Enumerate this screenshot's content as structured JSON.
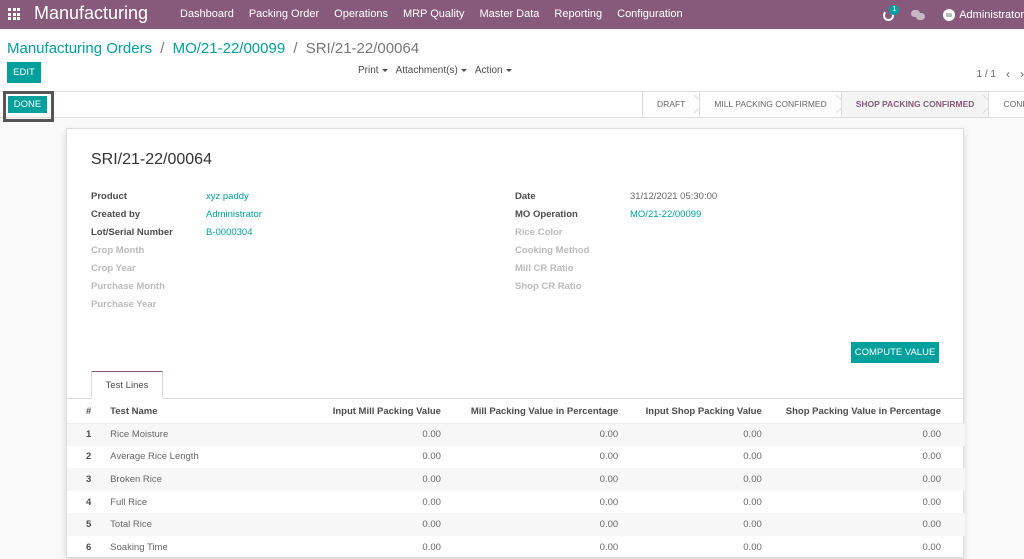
{
  "navbar": {
    "brand": "Manufacturing",
    "menu": [
      "Dashboard",
      "Packing Order",
      "Operations",
      "MRP Quality",
      "Master Data",
      "Reporting",
      "Configuration"
    ],
    "activity_count": "1",
    "user": "Administrator"
  },
  "breadcrumb": {
    "root": "Manufacturing Orders",
    "parent": "MO/21-22/00099",
    "current": "SRI/21-22/00064",
    "sep": "/"
  },
  "toolbar": {
    "edit_label": "EDIT",
    "print_label": "Print",
    "attachments_label": "Attachment(s)",
    "action_label": "Action",
    "pager": "1 / 1"
  },
  "statusbar": {
    "done_label": "DONE",
    "stages": [
      {
        "label": "DRAFT",
        "active": false
      },
      {
        "label": "MILL PACKING CONFIRMED",
        "active": false
      },
      {
        "label": "SHOP PACKING CONFIRMED",
        "active": true
      },
      {
        "label": "CONFIRMED",
        "active": false
      }
    ]
  },
  "record": {
    "title": "SRI/21-22/00064",
    "left_fields": [
      {
        "label": "Product",
        "value": "xyz paddy",
        "link": true
      },
      {
        "label": "Created by",
        "value": "Administrator",
        "link": true
      },
      {
        "label": "Lot/Serial Number",
        "value": "B-0000304",
        "link": true
      },
      {
        "label": "Crop Month",
        "value": "",
        "link": false
      },
      {
        "label": "Crop Year",
        "value": "",
        "link": false
      },
      {
        "label": "Purchase Month",
        "value": "",
        "link": false
      },
      {
        "label": "Purchase Year",
        "value": "",
        "link": false
      }
    ],
    "right_fields": [
      {
        "label": "Date",
        "value": "31/12/2021 05:30:00",
        "link": false
      },
      {
        "label": "MO Operation",
        "value": "MO/21-22/00099",
        "link": true
      },
      {
        "label": "Rice Color",
        "value": "",
        "link": false
      },
      {
        "label": "Cooking Method",
        "value": "",
        "link": false
      },
      {
        "label": "Mill CR Ratio",
        "value": "",
        "link": false
      },
      {
        "label": "Shop CR Ratio",
        "value": "",
        "link": false
      }
    ],
    "compute_label": "COMPUTE VALUE"
  },
  "tabs": [
    "Test Lines"
  ],
  "test_lines": {
    "columns": [
      "#",
      "Test Name",
      "Input Mill Packing Value",
      "Mill Packing Value in Percentage",
      "Input Shop Packing Value",
      "Shop Packing Value in Percentage"
    ],
    "rows": [
      [
        "1",
        "Rice Moisture",
        "0.00",
        "0.00",
        "0.00",
        "0.00"
      ],
      [
        "2",
        "Average Rice Length",
        "0.00",
        "0.00",
        "0.00",
        "0.00"
      ],
      [
        "3",
        "Broken Rice",
        "0.00",
        "0.00",
        "0.00",
        "0.00"
      ],
      [
        "4",
        "Full Rice",
        "0.00",
        "0.00",
        "0.00",
        "0.00"
      ],
      [
        "5",
        "Total Rice",
        "0.00",
        "0.00",
        "0.00",
        "0.00"
      ],
      [
        "6",
        "Soaking Time",
        "0.00",
        "0.00",
        "0.00",
        "0.00"
      ]
    ]
  },
  "colors": {
    "brand": "#875a7b",
    "accent": "#00a09d"
  }
}
